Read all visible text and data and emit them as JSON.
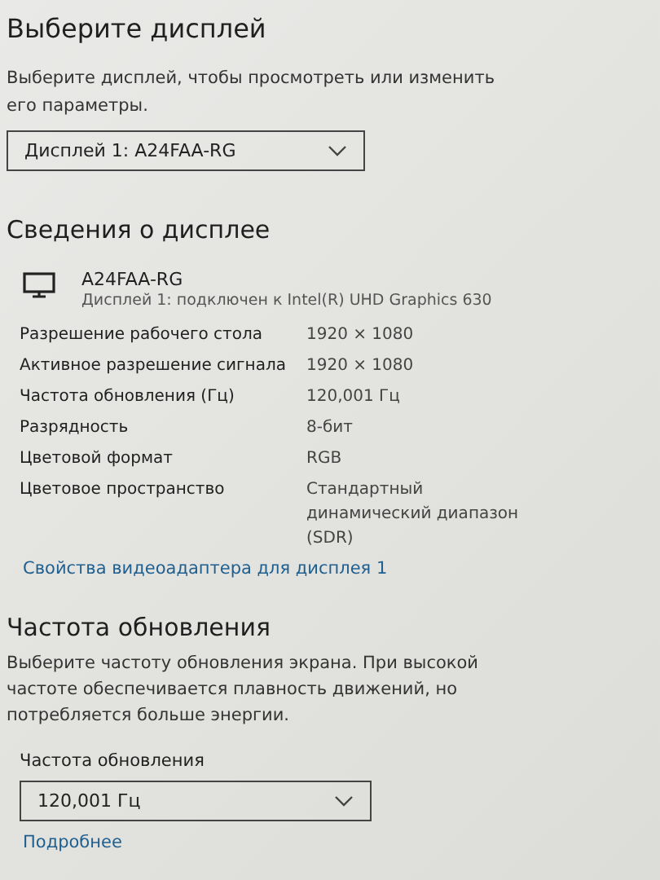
{
  "display_select": {
    "title": "Выберите дисплей",
    "description": "Выберите дисплей, чтобы просмотреть или изменить его параметры.",
    "dropdown": {
      "value": "Дисплей 1: A24FAA-RG"
    }
  },
  "display_info": {
    "title": "Сведения о дисплее",
    "monitor_name": "A24FAA-RG",
    "connection": "Дисплей 1: подключен к Intel(R) UHD Graphics 630",
    "rows": [
      {
        "label": "Разрешение рабочего стола",
        "value": "1920 × 1080"
      },
      {
        "label": "Активное разрешение сигнала",
        "value": "1920 × 1080"
      },
      {
        "label": "Частота обновления (Гц)",
        "value": "120,001 Гц"
      },
      {
        "label": "Разрядность",
        "value": "8-бит"
      },
      {
        "label": "Цветовой формат",
        "value": "RGB"
      },
      {
        "label": "Цветовое пространство",
        "value": "Стандартный динамический диапазон (SDR)"
      }
    ],
    "link": "Свойства видеоадаптера для дисплея 1"
  },
  "refresh_rate": {
    "title": "Частота обновления",
    "description": "Выберите частоту обновления экрана. При высокой частоте обеспечивается плавность движений, но потребляется больше энергии.",
    "field_label": "Частота обновления",
    "dropdown": {
      "value": "120,001 Гц"
    },
    "link": "Подробнее"
  }
}
